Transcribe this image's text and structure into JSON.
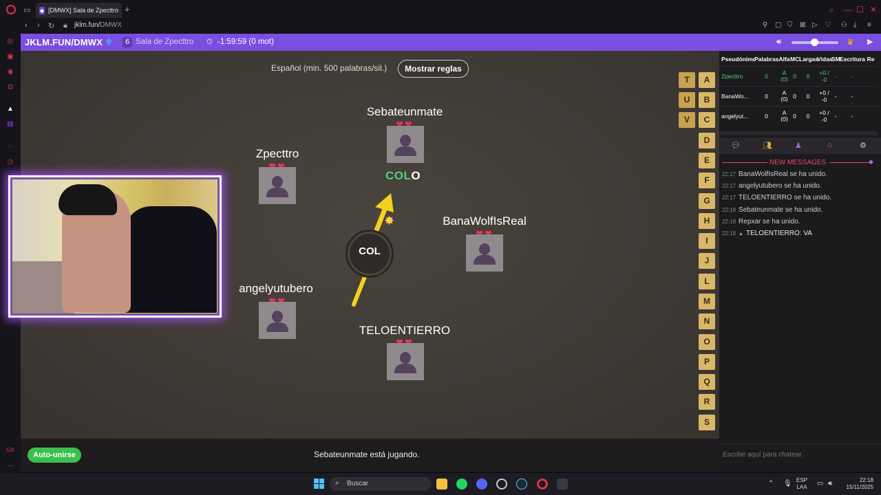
{
  "browser": {
    "tab_title": "[DMWX] Sala de Zpecttro",
    "url_host": "jklm.fun/",
    "url_path": "DMWX"
  },
  "topbar": {
    "site": "JKLM.FUN/DMWX",
    "player_count": "6",
    "room_name": "Sala de Zpecttro",
    "timer": "-1:59:59 (0 mot)"
  },
  "game": {
    "rules_text": "Español (min. 500 palabras/sil.)",
    "rules_button": "Mostrar reglas",
    "current_word_typed": "COL",
    "current_word_rest": "O",
    "syllable": "COL",
    "hearts": "❤❤",
    "players": [
      {
        "name": "Sebateunmate"
      },
      {
        "name": "Zpecttro"
      },
      {
        "name": "BanaWolfIsReal"
      },
      {
        "name": "angelyutubero"
      },
      {
        "name": "TELOENTIERRO"
      }
    ],
    "letters_col1": [
      "T",
      "U",
      "V"
    ],
    "letters_col2": [
      "A",
      "B",
      "C",
      "D",
      "E",
      "F",
      "G",
      "H",
      "I",
      "J",
      "L",
      "M",
      "N",
      "O",
      "P",
      "Q",
      "R",
      "S"
    ]
  },
  "bottom": {
    "autojoin": "Auto-unirse",
    "status": "Sebateunmate está jugando."
  },
  "table": {
    "headers": [
      "Pseudónimo",
      "Palabras",
      "Alfa",
      "MC",
      "Largas",
      "Vidas",
      "SM",
      "Escritura",
      "Re"
    ],
    "rows": [
      [
        "Zpecttro",
        "0",
        "A (0)",
        "0",
        "0",
        "+0 / -0",
        "-",
        "-",
        ""
      ],
      [
        "BanaWo...",
        "0",
        "A (0)",
        "0",
        "0",
        "+0 / -0",
        "-",
        "-",
        ""
      ],
      [
        "angelyut...",
        "0",
        "A (0)",
        "0",
        "0",
        "+0 / -0",
        "-",
        "-",
        ""
      ]
    ]
  },
  "chat": {
    "new_messages": "NEW MESSAGES",
    "messages": [
      {
        "time": "22:17",
        "text": "BanaWolfIsReal se ha unido."
      },
      {
        "time": "22:17",
        "text": "angelyutubero  se ha unido."
      },
      {
        "time": "22:17",
        "text": "TELOENTIERRO se ha unido."
      },
      {
        "time": "22:18",
        "text": "Sebateunmate se ha unido."
      },
      {
        "time": "22:18",
        "text": "Repxar se ha unido."
      },
      {
        "time": "22:18",
        "text": "TELOENTIERRO: VA"
      }
    ],
    "placeholder": "Escribe aquí para chatear."
  },
  "taskbar": {
    "search": "Buscar",
    "lang1": "ESP",
    "lang2": "LAA",
    "time": "22:18",
    "date": "15/11/2025"
  },
  "colors": {
    "accent": "#7a4ee0",
    "heart": "#e8335c",
    "typed": "#4ed37a",
    "letter": "#d8b868",
    "autojoin": "#3cbf4c"
  }
}
